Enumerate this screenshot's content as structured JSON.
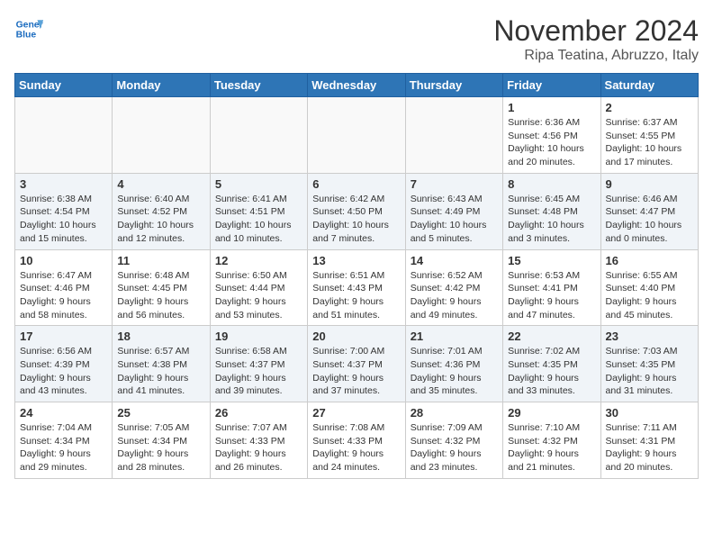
{
  "header": {
    "logo_line1": "General",
    "logo_line2": "Blue",
    "title": "November 2024",
    "subtitle": "Ripa Teatina, Abruzzo, Italy"
  },
  "days_of_week": [
    "Sunday",
    "Monday",
    "Tuesday",
    "Wednesday",
    "Thursday",
    "Friday",
    "Saturday"
  ],
  "weeks": [
    [
      {
        "day": "",
        "info": ""
      },
      {
        "day": "",
        "info": ""
      },
      {
        "day": "",
        "info": ""
      },
      {
        "day": "",
        "info": ""
      },
      {
        "day": "",
        "info": ""
      },
      {
        "day": "1",
        "info": "Sunrise: 6:36 AM\nSunset: 4:56 PM\nDaylight: 10 hours\nand 20 minutes."
      },
      {
        "day": "2",
        "info": "Sunrise: 6:37 AM\nSunset: 4:55 PM\nDaylight: 10 hours\nand 17 minutes."
      }
    ],
    [
      {
        "day": "3",
        "info": "Sunrise: 6:38 AM\nSunset: 4:54 PM\nDaylight: 10 hours\nand 15 minutes."
      },
      {
        "day": "4",
        "info": "Sunrise: 6:40 AM\nSunset: 4:52 PM\nDaylight: 10 hours\nand 12 minutes."
      },
      {
        "day": "5",
        "info": "Sunrise: 6:41 AM\nSunset: 4:51 PM\nDaylight: 10 hours\nand 10 minutes."
      },
      {
        "day": "6",
        "info": "Sunrise: 6:42 AM\nSunset: 4:50 PM\nDaylight: 10 hours\nand 7 minutes."
      },
      {
        "day": "7",
        "info": "Sunrise: 6:43 AM\nSunset: 4:49 PM\nDaylight: 10 hours\nand 5 minutes."
      },
      {
        "day": "8",
        "info": "Sunrise: 6:45 AM\nSunset: 4:48 PM\nDaylight: 10 hours\nand 3 minutes."
      },
      {
        "day": "9",
        "info": "Sunrise: 6:46 AM\nSunset: 4:47 PM\nDaylight: 10 hours\nand 0 minutes."
      }
    ],
    [
      {
        "day": "10",
        "info": "Sunrise: 6:47 AM\nSunset: 4:46 PM\nDaylight: 9 hours\nand 58 minutes."
      },
      {
        "day": "11",
        "info": "Sunrise: 6:48 AM\nSunset: 4:45 PM\nDaylight: 9 hours\nand 56 minutes."
      },
      {
        "day": "12",
        "info": "Sunrise: 6:50 AM\nSunset: 4:44 PM\nDaylight: 9 hours\nand 53 minutes."
      },
      {
        "day": "13",
        "info": "Sunrise: 6:51 AM\nSunset: 4:43 PM\nDaylight: 9 hours\nand 51 minutes."
      },
      {
        "day": "14",
        "info": "Sunrise: 6:52 AM\nSunset: 4:42 PM\nDaylight: 9 hours\nand 49 minutes."
      },
      {
        "day": "15",
        "info": "Sunrise: 6:53 AM\nSunset: 4:41 PM\nDaylight: 9 hours\nand 47 minutes."
      },
      {
        "day": "16",
        "info": "Sunrise: 6:55 AM\nSunset: 4:40 PM\nDaylight: 9 hours\nand 45 minutes."
      }
    ],
    [
      {
        "day": "17",
        "info": "Sunrise: 6:56 AM\nSunset: 4:39 PM\nDaylight: 9 hours\nand 43 minutes."
      },
      {
        "day": "18",
        "info": "Sunrise: 6:57 AM\nSunset: 4:38 PM\nDaylight: 9 hours\nand 41 minutes."
      },
      {
        "day": "19",
        "info": "Sunrise: 6:58 AM\nSunset: 4:37 PM\nDaylight: 9 hours\nand 39 minutes."
      },
      {
        "day": "20",
        "info": "Sunrise: 7:00 AM\nSunset: 4:37 PM\nDaylight: 9 hours\nand 37 minutes."
      },
      {
        "day": "21",
        "info": "Sunrise: 7:01 AM\nSunset: 4:36 PM\nDaylight: 9 hours\nand 35 minutes."
      },
      {
        "day": "22",
        "info": "Sunrise: 7:02 AM\nSunset: 4:35 PM\nDaylight: 9 hours\nand 33 minutes."
      },
      {
        "day": "23",
        "info": "Sunrise: 7:03 AM\nSunset: 4:35 PM\nDaylight: 9 hours\nand 31 minutes."
      }
    ],
    [
      {
        "day": "24",
        "info": "Sunrise: 7:04 AM\nSunset: 4:34 PM\nDaylight: 9 hours\nand 29 minutes."
      },
      {
        "day": "25",
        "info": "Sunrise: 7:05 AM\nSunset: 4:34 PM\nDaylight: 9 hours\nand 28 minutes."
      },
      {
        "day": "26",
        "info": "Sunrise: 7:07 AM\nSunset: 4:33 PM\nDaylight: 9 hours\nand 26 minutes."
      },
      {
        "day": "27",
        "info": "Sunrise: 7:08 AM\nSunset: 4:33 PM\nDaylight: 9 hours\nand 24 minutes."
      },
      {
        "day": "28",
        "info": "Sunrise: 7:09 AM\nSunset: 4:32 PM\nDaylight: 9 hours\nand 23 minutes."
      },
      {
        "day": "29",
        "info": "Sunrise: 7:10 AM\nSunset: 4:32 PM\nDaylight: 9 hours\nand 21 minutes."
      },
      {
        "day": "30",
        "info": "Sunrise: 7:11 AM\nSunset: 4:31 PM\nDaylight: 9 hours\nand 20 minutes."
      }
    ]
  ]
}
